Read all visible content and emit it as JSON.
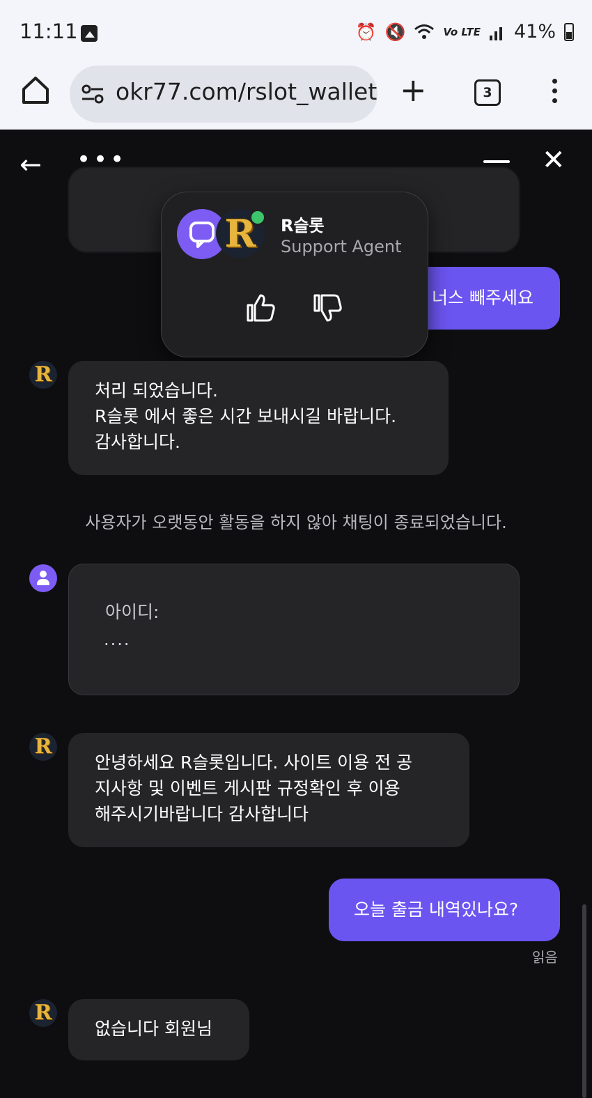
{
  "status_bar": {
    "time": "11:11",
    "network": "Vo LTE",
    "battery_percent": "41%",
    "icons": [
      "gallery-icon",
      "alarm-icon",
      "mute-icon",
      "wifi-icon",
      "signal-icon",
      "battery-icon"
    ]
  },
  "browser": {
    "url": "okr77.com/rslot_wallet",
    "tab_count": "3"
  },
  "agent_card": {
    "brand_logo": "R",
    "name": "R슬롯",
    "role": "Support Agent"
  },
  "messages": {
    "m1_partial": "너스 빼주세요",
    "m2": [
      "처리 되었습니다.",
      "R슬롯 에서 좋은 시간 보내시길 바랍니다.",
      "감사합니다."
    ],
    "system_notice": "사용자가 오랫동안 활동을 하지 않아 채팅이 종료되었습니다.",
    "m3_label": "아이디:",
    "m3_value_partial": "....",
    "m4": [
      "안녕하세요 R슬롯입니다. 사이트 이용 전 공",
      "지사항 및 이벤트 게시판 규정확인 후 이용",
      "해주시기바랍니다 감사합니다"
    ],
    "m5": "오늘 출금 내역있나요?",
    "m5_status": "읽음",
    "m6": "없습니다 회원님"
  },
  "avatar_letter": "R",
  "colors": {
    "background": "#0e0e10",
    "user_bubble": "#6b55f0",
    "agent_bubble": "#252528",
    "online": "#3cc56b"
  }
}
